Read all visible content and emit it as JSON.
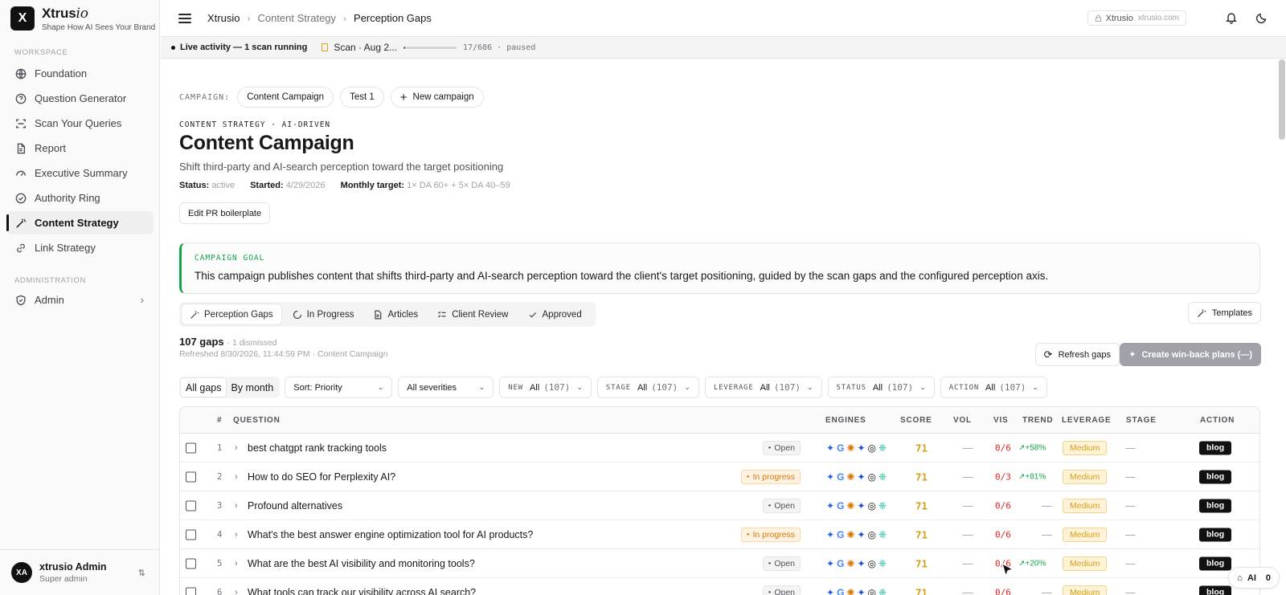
{
  "brand": {
    "logo_letter": "X",
    "name_plain": "Xtrus",
    "name_italic": "io",
    "tagline": "Shape How AI Sees Your Brand"
  },
  "sidebar": {
    "workspace_label": "WORKSPACE",
    "items": [
      {
        "label": "Foundation",
        "icon": "globe-icon"
      },
      {
        "label": "Question Generator",
        "icon": "help-circle-icon"
      },
      {
        "label": "Scan Your Queries",
        "icon": "scan-icon"
      },
      {
        "label": "Report",
        "icon": "file-icon"
      },
      {
        "label": "Executive Summary",
        "icon": "gauge-icon"
      },
      {
        "label": "Authority Ring",
        "icon": "check-circle-icon"
      },
      {
        "label": "Content Strategy",
        "icon": "wand-icon",
        "active": true
      },
      {
        "label": "Link Strategy",
        "icon": "link-icon"
      }
    ],
    "admin_label": "ADMINISTRATION",
    "admin_item": "Admin"
  },
  "user": {
    "initials": "XA",
    "name": "xtrusio Admin",
    "role": "Super admin"
  },
  "topbar": {
    "crumbs": [
      "Xtrusio",
      "Content Strategy",
      "Perception Gaps"
    ],
    "domain_name": "Xtrusio",
    "domain_url": "xtrusio.com"
  },
  "activity": {
    "live": "Live activity — 1 scan running",
    "scan": "Scan · Aug 2...",
    "progress_text": "17/686 · paused",
    "progress_fraction": 0.025
  },
  "campaign": {
    "label": "CAMPAIGN:",
    "pills": [
      "Content Campaign",
      "Test 1"
    ],
    "new_label": "New campaign",
    "eyebrow": "CONTENT STRATEGY · AI-DRIVEN",
    "title": "Content Campaign",
    "subtitle": "Shift third-party and AI-search perception toward the target positioning",
    "status_label": "Status:",
    "status_value": "active",
    "started_label": "Started:",
    "started_value": "4/29/2026",
    "target_label": "Monthly target:",
    "target_value": "1× DA 60+ + 5× DA 40–59",
    "edit_button": "Edit PR boilerplate",
    "goal_label": "CAMPAIGN GOAL",
    "goal_text": "This campaign publishes content that shifts third-party and AI-search perception toward the client's target positioning, guided by the scan gaps and the configured perception axis."
  },
  "tabs": [
    "Perception Gaps",
    "In Progress",
    "Articles",
    "Client Review",
    "Approved"
  ],
  "templates_button": "Templates",
  "gaps": {
    "count": "107 gaps",
    "dismissed": "· 1 dismissed",
    "refreshed": "Refreshed 8/30/2026, 11:44:59 PM · Content Campaign",
    "refresh_button": "Refresh gaps",
    "create_button": "Create win-back plans (—)"
  },
  "filters": {
    "seg": [
      "All gaps",
      "By month"
    ],
    "sort": "Sort: Priority",
    "severity": "All severities",
    "selects": [
      {
        "key": "NEW",
        "value": "All",
        "count": "(107)"
      },
      {
        "key": "STAGE",
        "value": "All",
        "count": "(107)"
      },
      {
        "key": "LEVERAGE",
        "value": "All",
        "count": "(107)"
      },
      {
        "key": "STATUS",
        "value": "All",
        "count": "(107)"
      },
      {
        "key": "ACTION",
        "value": "All",
        "count": "(107)"
      }
    ]
  },
  "table": {
    "headers": [
      "#",
      "QUESTION",
      "ENGINES",
      "SCORE",
      "VOL",
      "VIS",
      "TREND",
      "LEVERAGE",
      "STAGE",
      "ACTION"
    ],
    "rows": [
      {
        "n": "1",
        "q": "best chatgpt rank tracking tools",
        "status": "Open",
        "score": "71",
        "vol": "—",
        "vis": "0/6",
        "trend": "+58%",
        "lev": "Medium",
        "stage": "—",
        "action": "blog"
      },
      {
        "n": "2",
        "q": "How to do SEO for Perplexity AI?",
        "status": "In progress",
        "score": "71",
        "vol": "—",
        "vis": "0/3",
        "trend": "+81%",
        "lev": "Medium",
        "stage": "—",
        "action": "blog"
      },
      {
        "n": "3",
        "q": "Profound alternatives",
        "status": "Open",
        "score": "71",
        "vol": "—",
        "vis": "0/6",
        "trend": "—",
        "lev": "Medium",
        "stage": "—",
        "action": "blog"
      },
      {
        "n": "4",
        "q": "What's the best answer engine optimization tool for AI products?",
        "status": "In progress",
        "score": "71",
        "vol": "—",
        "vis": "0/6",
        "trend": "—",
        "lev": "Medium",
        "stage": "—",
        "action": "blog"
      },
      {
        "n": "5",
        "q": "What are the best AI visibility and monitoring tools?",
        "status": "Open",
        "score": "71",
        "vol": "—",
        "vis": "0/6",
        "trend": "+20%",
        "lev": "Medium",
        "stage": "—",
        "action": "blog"
      },
      {
        "n": "6",
        "q": "What tools can track our visibility across AI search?",
        "status": "Open",
        "score": "71",
        "vol": "—",
        "vis": "0/6",
        "trend": "—",
        "lev": "Medium",
        "stage": "—",
        "action": "blog"
      }
    ]
  },
  "ai_chip": {
    "label": "AI",
    "count": "0"
  },
  "colors": {
    "accent_green": "#16a34a",
    "score_amber": "#d4a017",
    "vis_red": "#dc2626",
    "inprogress_orange": "#d97706"
  }
}
